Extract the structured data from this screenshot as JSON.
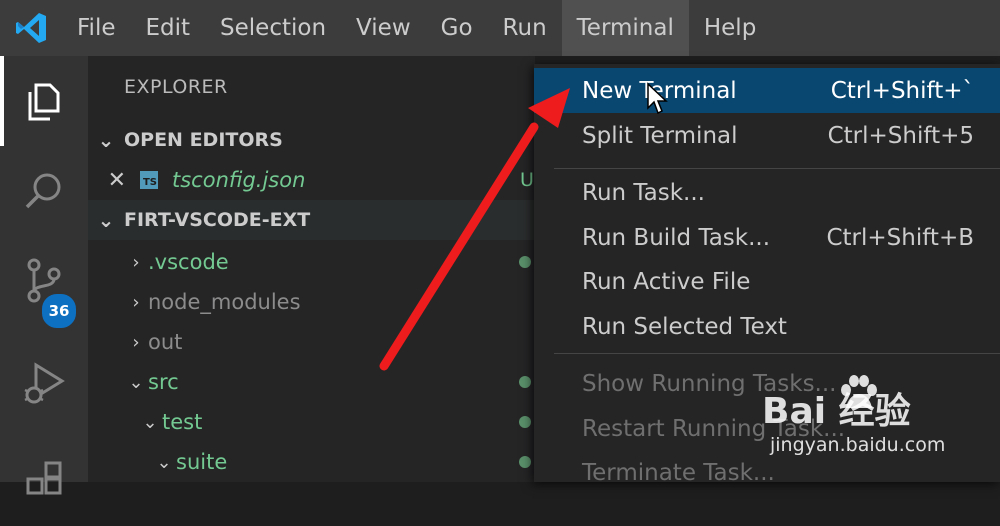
{
  "menubar": {
    "items": [
      "File",
      "Edit",
      "Selection",
      "View",
      "Go",
      "Run",
      "Terminal",
      "Help"
    ],
    "active": "Terminal"
  },
  "activity_bar": {
    "icons": [
      "explorer-icon",
      "search-icon",
      "source-control-icon",
      "run-debug-icon",
      "extensions-icon"
    ],
    "source_control_badge": "36"
  },
  "explorer": {
    "title": "EXPLORER",
    "open_editors": {
      "header": "OPEN EDITORS",
      "files": [
        {
          "name": "tsconfig.json",
          "icon_text": "TS",
          "status": "U"
        }
      ]
    },
    "project": {
      "header": "FIRT-VSCODE-EXT",
      "items": [
        {
          "name": ".vscode",
          "expanded": false,
          "depth": 0,
          "color": "#73c991"
        },
        {
          "name": "node_modules",
          "expanded": false,
          "depth": 0,
          "color": "#8c8c8c"
        },
        {
          "name": "out",
          "expanded": false,
          "depth": 0,
          "color": "#8c8c8c"
        },
        {
          "name": "src",
          "expanded": true,
          "depth": 0,
          "color": "#73c991"
        },
        {
          "name": "test",
          "expanded": true,
          "depth": 1,
          "color": "#73c991"
        },
        {
          "name": "suite",
          "expanded": true,
          "depth": 2,
          "color": "#73c991"
        }
      ]
    }
  },
  "terminal_menu": {
    "items": [
      {
        "label": "New Terminal",
        "shortcut": "Ctrl+Shift+`",
        "highlighted": true,
        "disabled": false
      },
      {
        "label": "Split Terminal",
        "shortcut": "Ctrl+Shift+5",
        "highlighted": false,
        "disabled": false
      },
      {
        "label": "Run Task...",
        "shortcut": "",
        "highlighted": false,
        "disabled": false
      },
      {
        "label": "Run Build Task...",
        "shortcut": "Ctrl+Shift+B",
        "highlighted": false,
        "disabled": false
      },
      {
        "label": "Run Active File",
        "shortcut": "",
        "highlighted": false,
        "disabled": false
      },
      {
        "label": "Run Selected Text",
        "shortcut": "",
        "highlighted": false,
        "disabled": false
      },
      {
        "label": "Show Running Tasks...",
        "shortcut": "",
        "highlighted": false,
        "disabled": true
      },
      {
        "label": "Restart Running Task...",
        "shortcut": "",
        "highlighted": false,
        "disabled": true
      },
      {
        "label": "Terminate Task...",
        "shortcut": "",
        "highlighted": false,
        "disabled": true
      }
    ]
  },
  "colors": {
    "accent": "#094771",
    "badge": "#0e70c0",
    "annotation_arrow": "#ee1c1c",
    "untracked": "#73c991"
  },
  "watermark": {
    "brand": "Bai 经验",
    "url": "jingyan.baidu.com"
  }
}
